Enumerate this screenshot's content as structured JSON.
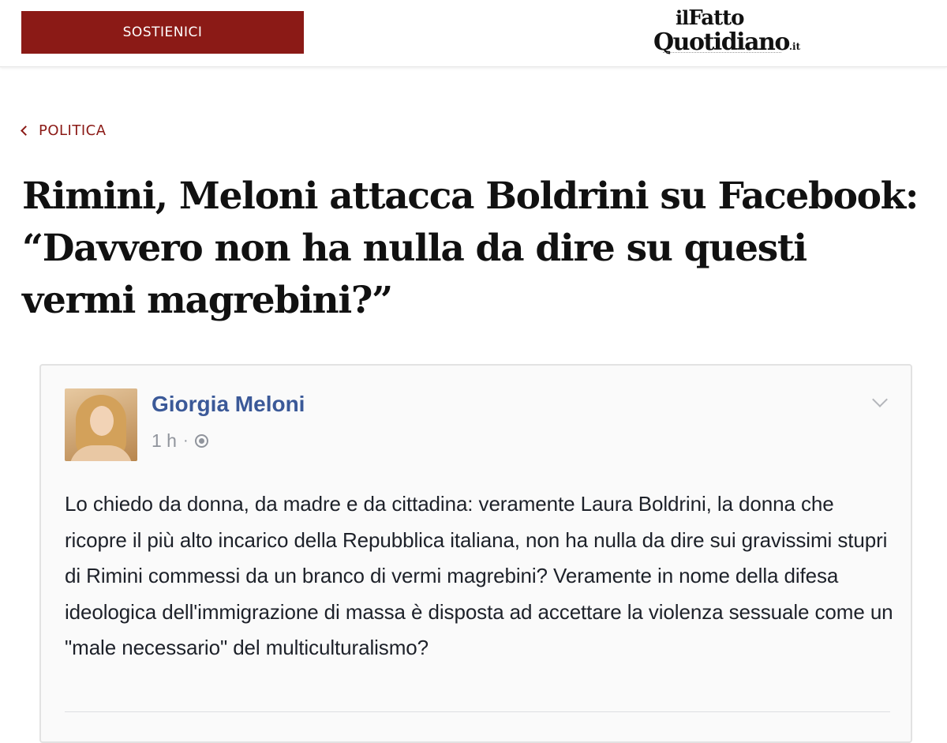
{
  "header": {
    "support_label": "SOSTIENICI",
    "logo": {
      "line1_prefix": "il",
      "line1_word": "Fatto",
      "line2_word": "Quotidiano",
      "line2_suffix": ".it"
    }
  },
  "breadcrumb": {
    "section": "POLITICA"
  },
  "article": {
    "headline": "Rimini, Meloni attacca Boldrini su Facebook: “Davvero non ha nulla da dire su questi vermi magrebini?”"
  },
  "facebook_post": {
    "author": "Giorgia Meloni",
    "time": "1 h",
    "separator": "·",
    "audience_icon": "globe-icon",
    "menu_icon": "chevron-down-icon",
    "text": "Lo chiedo da donna, da madre e da cittadina: veramente Laura Boldrini, la donna che ricopre il più alto incarico della Repubblica italiana, non ha nulla da dire sui gravissimi stupri di Rimini commessi da un branco di vermi magrebini? Veramente in nome della difesa ideologica dell'immigrazione di massa è disposta ad accettare la violenza sessuale come un \"male necessario\" del multiculturalismo?"
  },
  "colors": {
    "brand_red": "#8b1a16",
    "facebook_blue": "#3b5998",
    "meta_gray": "#90949c"
  }
}
